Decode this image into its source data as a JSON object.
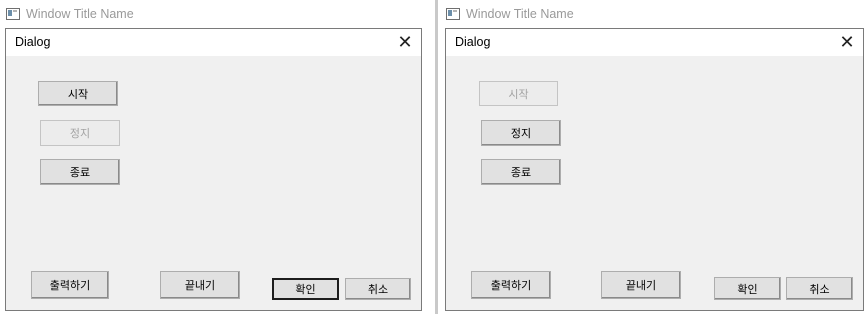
{
  "left": {
    "window_title": "Window Title Name",
    "dialog_title": "Dialog",
    "close_glyph": "✕",
    "buttons": {
      "start": {
        "label": "시작",
        "enabled": true
      },
      "stop": {
        "label": "정지",
        "enabled": false
      },
      "exit": {
        "label": "종료",
        "enabled": true
      },
      "print": {
        "label": "출력하기",
        "enabled": true
      },
      "finish": {
        "label": "끝내기",
        "enabled": true
      },
      "ok": {
        "label": "확인",
        "enabled": true,
        "default": true
      },
      "cancel": {
        "label": "취소",
        "enabled": true
      }
    }
  },
  "right": {
    "window_title": "Window Title Name",
    "dialog_title": "Dialog",
    "close_glyph": "✕",
    "buttons": {
      "start": {
        "label": "시작",
        "enabled": false
      },
      "stop": {
        "label": "정지",
        "enabled": true
      },
      "exit": {
        "label": "종료",
        "enabled": true
      },
      "print": {
        "label": "출력하기",
        "enabled": true
      },
      "finish": {
        "label": "끝내기",
        "enabled": true
      },
      "ok": {
        "label": "확인",
        "enabled": true
      },
      "cancel": {
        "label": "취소",
        "enabled": true
      }
    }
  }
}
